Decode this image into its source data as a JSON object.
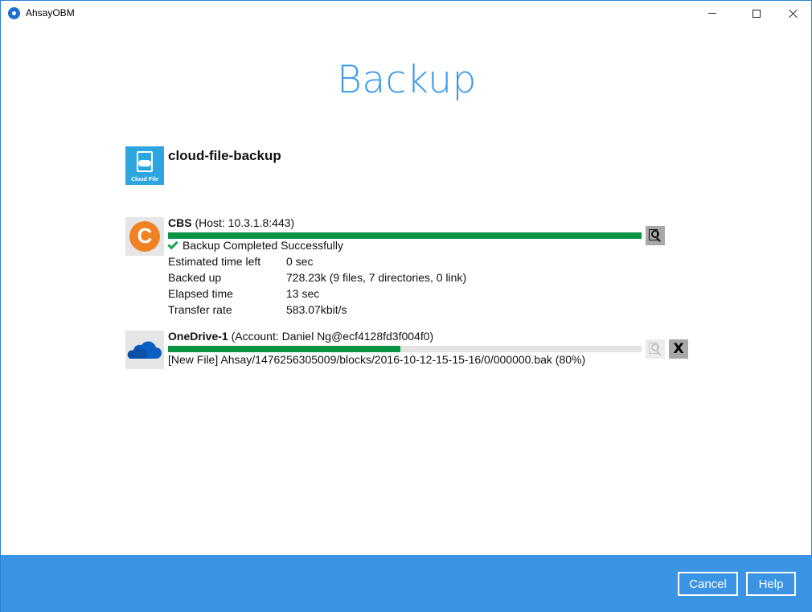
{
  "window": {
    "app_title": "AhsayOBM"
  },
  "page": {
    "title": "Backup"
  },
  "backup_set": {
    "name": "cloud-file-backup",
    "icon_caption": "Cloud File",
    "icon": "cloud-file-icon"
  },
  "destinations": [
    {
      "name": "CBS",
      "detail": "(Host: 10.3.1.8:443)",
      "icon": "cbs-logo-icon",
      "progress_fraction": 1.0,
      "status": "Backup Completed Successfully",
      "stats": [
        {
          "label": "Estimated time left",
          "value": "0 sec"
        },
        {
          "label": "Backed up",
          "value": "728.23k (9 files, 7 directories, 0 link)"
        },
        {
          "label": "Elapsed time",
          "value": "13 sec"
        },
        {
          "label": "Transfer rate",
          "value": "583.07kbit/s"
        }
      ]
    },
    {
      "name": "OneDrive-1",
      "detail": "(Account: Daniel Ng@ecf4128fd3f004f0)",
      "icon": "onedrive-icon",
      "progress_fraction": 0.49,
      "status": "[New File] Ahsay/1476256305009/blocks/2016-10-12-15-15-16/0/000000.bak (80%)",
      "cancel_label": "X"
    }
  ],
  "footer": {
    "cancel_label": "Cancel",
    "help_label": "Help"
  },
  "colors": {
    "accent": "#3a9ae8",
    "footer": "#3a94e3",
    "progress": "#0b9444",
    "cbs_brand": "#f08223",
    "onedrive_brand": "#0b5fc2"
  }
}
